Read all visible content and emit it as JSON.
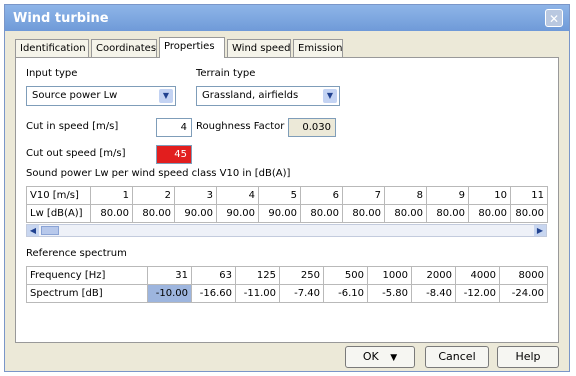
{
  "window": {
    "title": "Wind turbine",
    "close_glyph": "✕"
  },
  "tabs": [
    "Identification",
    "Coordinates",
    "Properties",
    "Wind speed",
    "Emission"
  ],
  "active_tab": "Properties",
  "input_type": {
    "label": "Input type",
    "value": "Source power Lw"
  },
  "terrain_type": {
    "label": "Terrain type",
    "value": "Grassland, airfields"
  },
  "cut_in": {
    "label": "Cut in speed [m/s]",
    "value": "4"
  },
  "roughness": {
    "label": "Roughness Factor",
    "value": "0.030"
  },
  "cut_out": {
    "label": "Cut out speed [m/s]",
    "value": "45"
  },
  "sound_power": {
    "caption": "Sound power Lw per wind speed class V10 in [dB(A)]",
    "row1_label": "V10 [m/s]",
    "row2_label": "Lw [dB(A)]",
    "v10": [
      "1",
      "2",
      "3",
      "4",
      "5",
      "6",
      "7",
      "8",
      "9",
      "10",
      "11"
    ],
    "lw": [
      "80.00",
      "80.00",
      "90.00",
      "90.00",
      "90.00",
      "80.00",
      "80.00",
      "80.00",
      "80.00",
      "80.00",
      "80.00"
    ]
  },
  "reference_spectrum": {
    "caption": "Reference spectrum",
    "row1_label": "Frequency [Hz]",
    "row2_label": "Spectrum [dB]",
    "freq": [
      "31",
      "63",
      "125",
      "250",
      "500",
      "1000",
      "2000",
      "4000",
      "8000"
    ],
    "spectrum": [
      "-10.00",
      "-16.60",
      "-11.00",
      "-7.40",
      "-6.10",
      "-5.80",
      "-8.40",
      "-12.00",
      "-24.00"
    ]
  },
  "buttons": {
    "ok": "OK",
    "cancel": "Cancel",
    "help": "Help"
  },
  "icons": {
    "combo_arrow": "chevron-down-icon",
    "ok_dropdown": "triangle-down-icon"
  }
}
